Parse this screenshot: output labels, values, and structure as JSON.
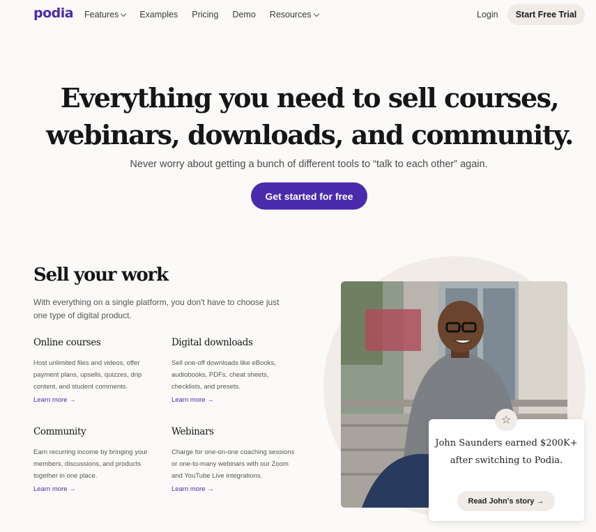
{
  "nav": {
    "logo": "podia",
    "links": [
      {
        "label": "Features",
        "dropdown": true
      },
      {
        "label": "Examples",
        "dropdown": false
      },
      {
        "label": "Pricing",
        "dropdown": false
      },
      {
        "label": "Demo",
        "dropdown": false
      },
      {
        "label": "Resources",
        "dropdown": true
      }
    ],
    "login": "Login",
    "trial": "Start Free Trial"
  },
  "hero": {
    "title_line1": "Everything you need to sell courses,",
    "title_line2": "webinars, downloads, and community.",
    "subtitle": "Never worry about getting a bunch of different tools to “talk to each other” again.",
    "cta": "Get started for free"
  },
  "sell": {
    "title": "Sell your work",
    "description": "With everything on a single platform, you don't have to choose just one type of digital product.",
    "features": [
      {
        "title": "Online courses",
        "description": "Host unlimited files and videos, offer payment plans, upsells, quizzes, drip content, and student comments.",
        "link": "Learn more →"
      },
      {
        "title": "Digital downloads",
        "description": "Sell one-off downloads like eBooks, audiobooks, PDFs, cheat sheets, checklists, and presets.",
        "link": "Learn more →"
      },
      {
        "title": "Community",
        "description": "Earn recurring income by bringing your members, discussions, and products together in one place.",
        "link": "Learn more →"
      },
      {
        "title": "Webinars",
        "description": "Charge for one-on-one coaching sessions or one-to-many webinars with our Zoom and YouTube Live integrations.",
        "link": "Learn more →"
      }
    ]
  },
  "story": {
    "text": "John Saunders earned $200K+ after switching to Podia.",
    "button": "Read John's story →"
  },
  "colors": {
    "brand": "#4b2aad",
    "background": "#fbfaf8",
    "pill": "#f0ebe6"
  },
  "icons": [
    "chevron-down-icon",
    "star-icon"
  ]
}
